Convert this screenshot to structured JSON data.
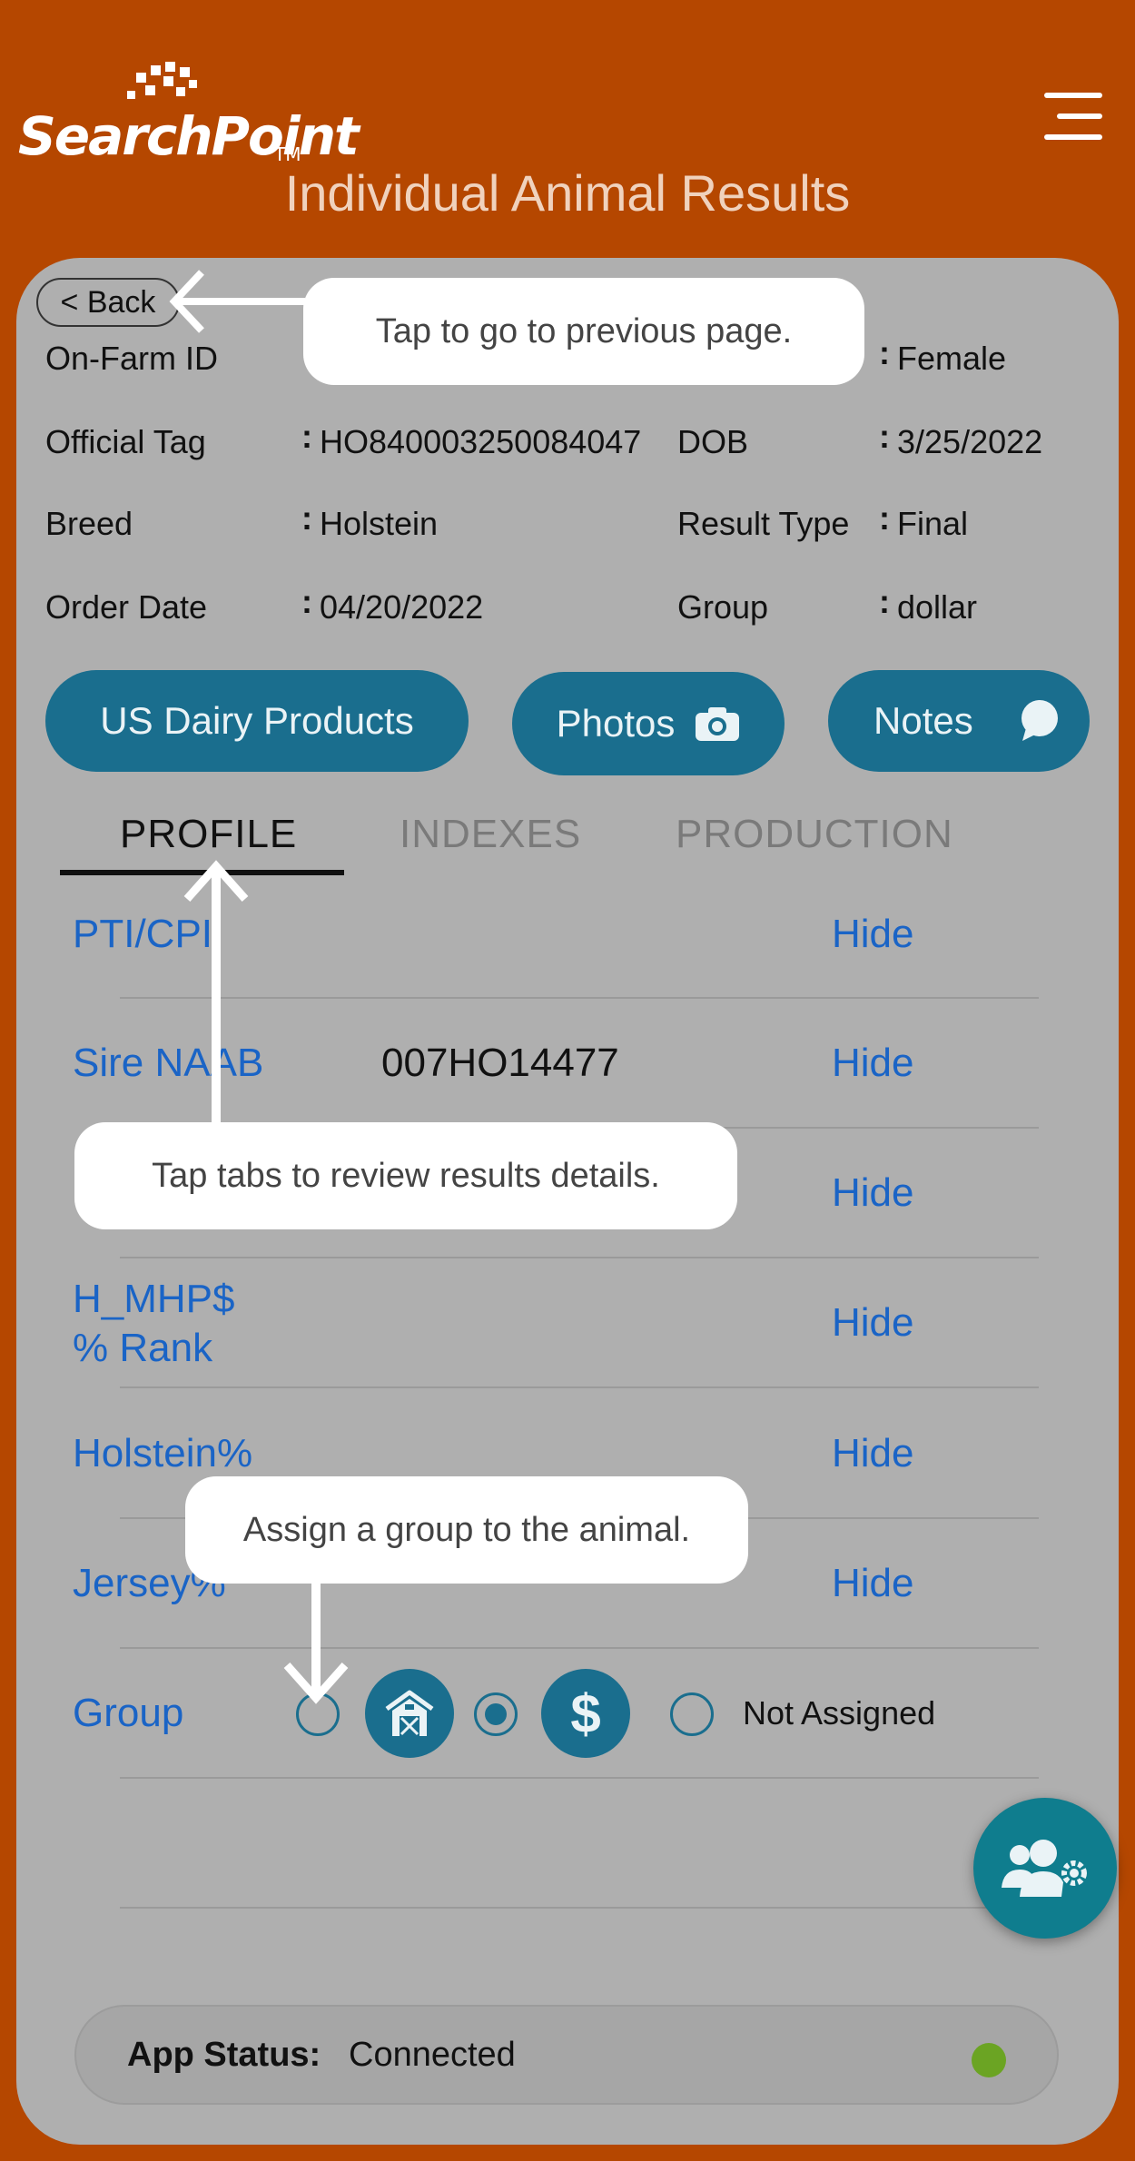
{
  "header": {
    "logo_text": "SearchPoint",
    "logo_tm": "TM",
    "title": "Individual Animal Results",
    "menu_icon": "hamburger-menu-icon"
  },
  "back_button": {
    "label": "< Back"
  },
  "animal_info": {
    "on_farm_id": {
      "label": "On-Farm ID",
      "value": ""
    },
    "sex": {
      "label": "",
      "value": "Female"
    },
    "official_tag": {
      "label": "Official Tag",
      "value": "HO840003250084047"
    },
    "dob": {
      "label": "DOB",
      "value": "3/25/2022"
    },
    "breed": {
      "label": "Breed",
      "value": "Holstein"
    },
    "result_type": {
      "label": "Result Type",
      "value": "Final"
    },
    "order_date": {
      "label": "Order Date",
      "value": "04/20/2022"
    },
    "group": {
      "label": "Group",
      "value": "dollar"
    }
  },
  "actions": {
    "us_dairy": "US Dairy Products",
    "photos": "Photos",
    "notes": "Notes"
  },
  "tabs": [
    {
      "label": "PROFILE",
      "active": true
    },
    {
      "label": "INDEXES",
      "active": false
    },
    {
      "label": "PRODUCTION",
      "active": false
    }
  ],
  "profile_rows": [
    {
      "label": "PTI/CPI",
      "value": "",
      "action": "Hide"
    },
    {
      "label": "Sire NAAB",
      "value": "007HO14477",
      "action": "Hide"
    },
    {
      "label": "",
      "value": "",
      "action": "Hide"
    },
    {
      "label_line1": "H_MHP$",
      "label_line2": "% Rank",
      "value": "",
      "action": "Hide"
    },
    {
      "label": "Holstein%",
      "value": "",
      "action": "Hide"
    },
    {
      "label": "Jersey%",
      "value": "",
      "action": "Hide"
    }
  ],
  "group_row": {
    "label": "Group",
    "options": [
      {
        "icon": "barn-icon",
        "selected": false
      },
      {
        "icon": "dollar-icon",
        "symbol": "$",
        "selected": true
      },
      {
        "label": "Not Assigned",
        "selected": false
      }
    ]
  },
  "fab": {
    "icon": "user-settings-icon"
  },
  "status": {
    "label": "App Status:",
    "value": "Connected",
    "indicator_color": "#6BA423"
  },
  "tooltips": {
    "back": "Tap to go to previous page.",
    "tabs": "Tap tabs to review results details.",
    "group": "Assign a group to the animal."
  },
  "colors": {
    "header_bg": "#B54700",
    "card_bg": "#AFAFAF",
    "accent": "#1A6E8E",
    "link": "#1A64C6"
  }
}
